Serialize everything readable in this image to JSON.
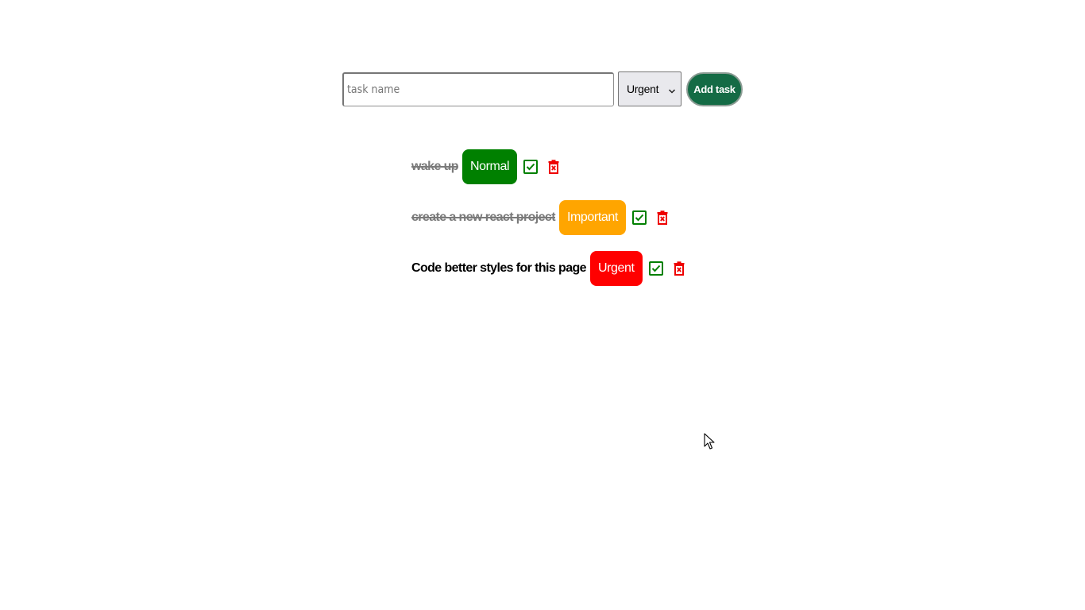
{
  "form": {
    "input_placeholder": "task name",
    "input_value": "",
    "priority_selected": "Urgent",
    "add_button_label": "Add task"
  },
  "colors": {
    "add_button": "#146b45",
    "normal": "#008000",
    "important": "#ffa500",
    "urgent": "#ff0000",
    "check_icon": "#008000",
    "trash_icon": "#ee0000"
  },
  "tasks": [
    {
      "name": "wake up",
      "priority": "Normal",
      "completed": true
    },
    {
      "name": "create a new react project",
      "priority": "Important",
      "completed": true
    },
    {
      "name": "Code better styles for this page",
      "priority": "Urgent",
      "completed": false
    }
  ],
  "icons": {
    "complete": "check-square-icon",
    "delete": "trash-x-icon",
    "dropdown": "chevron-down-icon"
  }
}
